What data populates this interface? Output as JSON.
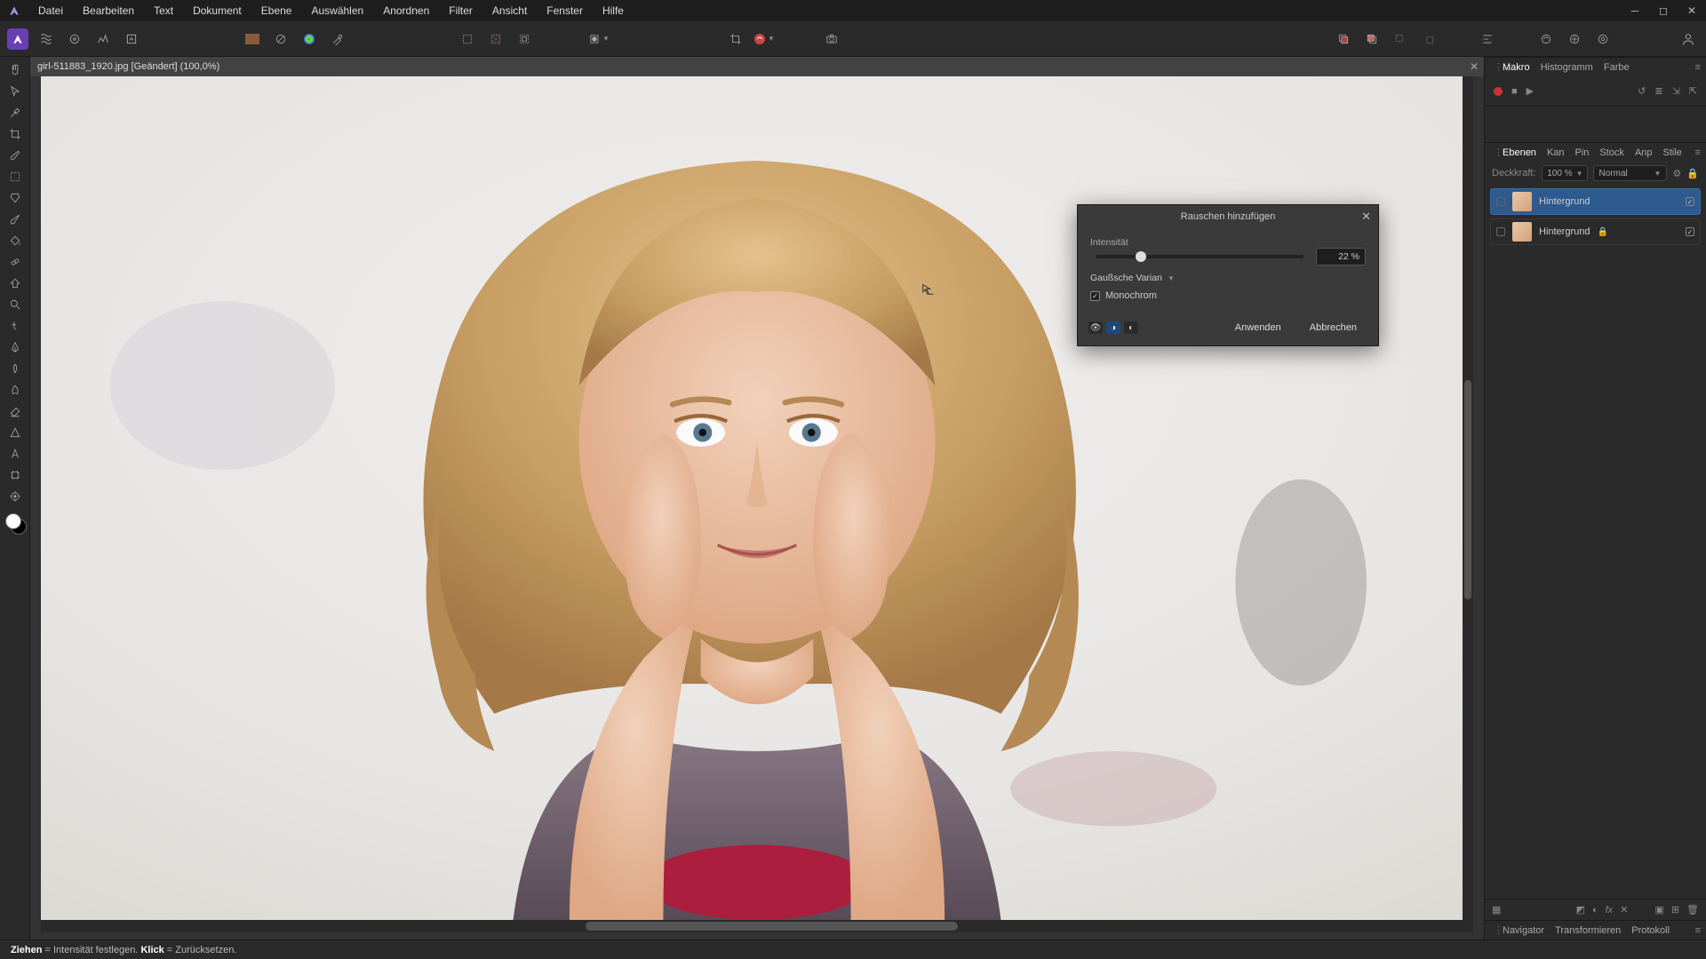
{
  "menu": {
    "items": [
      "Datei",
      "Bearbeiten",
      "Text",
      "Dokument",
      "Ebene",
      "Auswählen",
      "Anordnen",
      "Filter",
      "Ansicht",
      "Fenster",
      "Hilfe"
    ]
  },
  "document": {
    "tab_title": "girl-511883_1920.jpg [Geändert] (100,0%)"
  },
  "dialog": {
    "title": "Rauschen hinzufügen",
    "intensity_label": "Intensität",
    "intensity_value": "22 %",
    "intensity_percent": 22,
    "distribution": "Gaußsche Varian",
    "monochrome_label": "Monochrom",
    "monochrome_checked": true,
    "apply": "Anwenden",
    "cancel": "Abbrechen"
  },
  "panels": {
    "top_tabs": [
      "Makro",
      "Histogramm",
      "Farbe"
    ],
    "layer_tabs": [
      "Ebenen",
      "Kan",
      "Pin",
      "Stock",
      "Anp",
      "Stile"
    ],
    "opacity_label": "Deckkraft:",
    "opacity_value": "100 %",
    "blend_mode": "Normal",
    "layers": [
      {
        "name": "Hintergrund",
        "selected": true,
        "locked": false
      },
      {
        "name": "Hintergrund",
        "selected": false,
        "locked": true
      }
    ],
    "bottom_tabs": [
      "Navigator",
      "Transformieren",
      "Protokoll"
    ]
  },
  "statusbar": {
    "drag_word": "Ziehen",
    "drag_rest": " = Intensität festlegen. ",
    "click_word": "Klick",
    "click_rest": " = Zurücksetzen."
  },
  "colors": {
    "accent": "#2d5a8f",
    "app": "#6a3fb5"
  }
}
